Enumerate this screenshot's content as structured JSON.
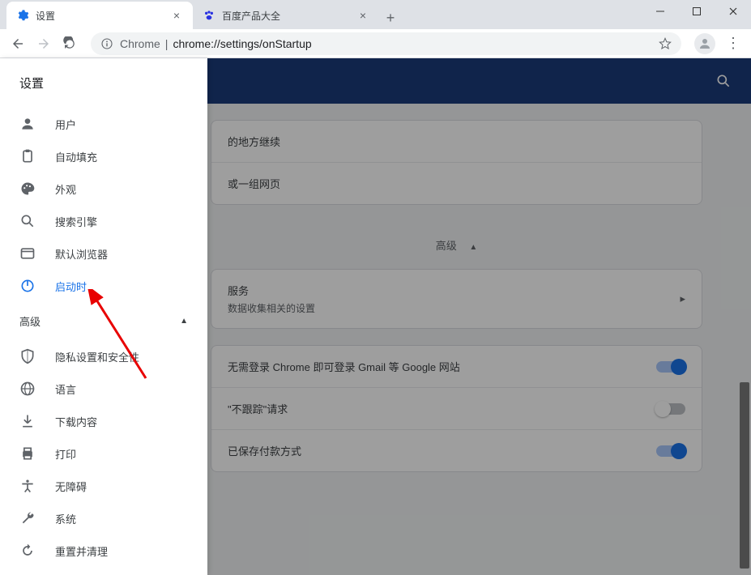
{
  "window": {
    "title_bar": true
  },
  "tabs": [
    {
      "label": "设置",
      "favicon": "gear-blue",
      "active": true
    },
    {
      "label": "百度产品大全",
      "favicon": "baidu-paw",
      "active": false
    }
  ],
  "toolbar": {
    "url_host": "Chrome",
    "url_path": "chrome://settings/onStartup"
  },
  "sidebar": {
    "title": "设置",
    "items": [
      {
        "icon": "person",
        "label": "用户"
      },
      {
        "icon": "clipboard",
        "label": "自动填充"
      },
      {
        "icon": "palette",
        "label": "外观"
      },
      {
        "icon": "search",
        "label": "搜索引擎"
      },
      {
        "icon": "browser",
        "label": "默认浏览器"
      },
      {
        "icon": "power",
        "label": "启动时",
        "active": true
      }
    ],
    "advanced_label": "高级",
    "advanced_items": [
      {
        "icon": "shield",
        "label": "隐私设置和安全性"
      },
      {
        "icon": "globe",
        "label": "语言"
      },
      {
        "icon": "download",
        "label": "下载内容"
      },
      {
        "icon": "printer",
        "label": "打印"
      },
      {
        "icon": "accessibility",
        "label": "无障碍"
      },
      {
        "icon": "wrench",
        "label": "系统"
      },
      {
        "icon": "restore",
        "label": "重置并清理"
      }
    ]
  },
  "main": {
    "card1_row1_suffix": "的地方继续",
    "card1_row2_suffix": "或一组网页",
    "advanced_divider": "高级",
    "sync_card": {
      "title_suffix": "服务",
      "subtitle_suffix": "数据收集相关的设置"
    },
    "rows": [
      {
        "text_suffix": "无需登录 Chrome 即可登录 Gmail 等 Google 网站",
        "toggle": "on"
      },
      {
        "text_suffix": "\"不跟踪\"请求",
        "toggle": "off"
      },
      {
        "text_suffix": "已保存付款方式",
        "toggle": "on"
      }
    ]
  }
}
